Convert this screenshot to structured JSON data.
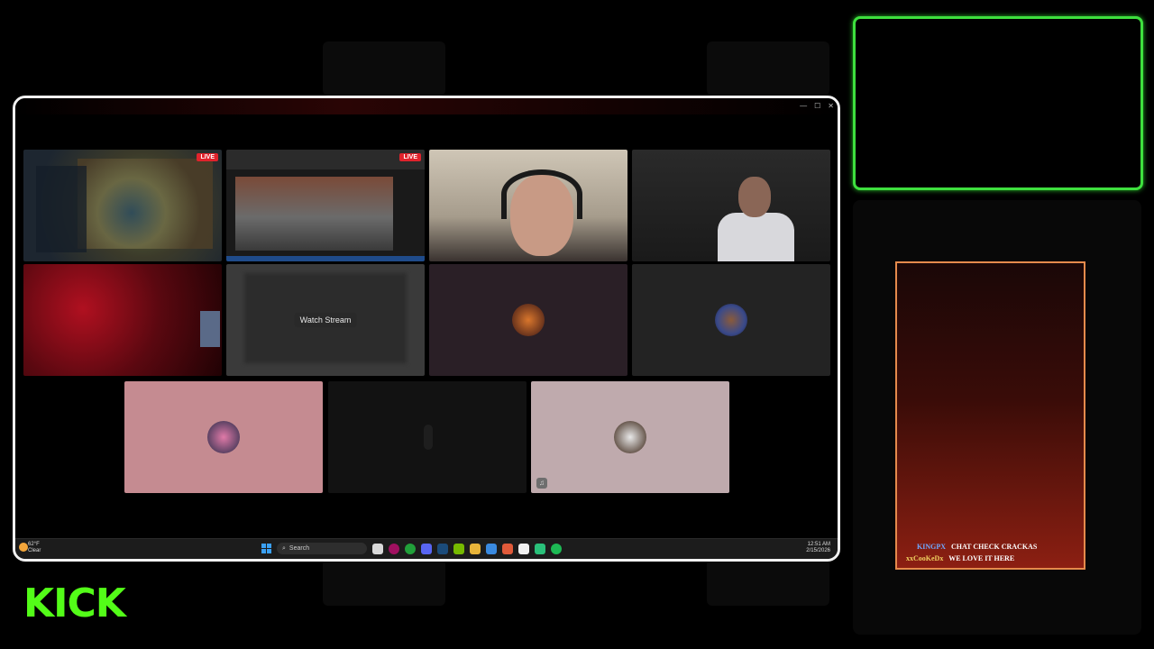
{
  "window": {
    "controls": [
      "—",
      "☐",
      "✕"
    ]
  },
  "grid": {
    "tiles": [
      {
        "kind": "screenshare-game",
        "live_badge": "LIVE"
      },
      {
        "kind": "screenshare-browser",
        "live_badge": "LIVE"
      },
      {
        "kind": "webcam"
      },
      {
        "kind": "webcam"
      },
      {
        "kind": "webcam-red"
      },
      {
        "kind": "screenshare-blurred",
        "overlay_label": "Watch Stream"
      },
      {
        "kind": "avatar",
        "bg": "#2a1f26"
      },
      {
        "kind": "avatar",
        "bg": "#232323"
      },
      {
        "kind": "avatar",
        "bg": "#c58b91"
      },
      {
        "kind": "avatar-dark",
        "bg": "#121212"
      },
      {
        "kind": "avatar",
        "bg": "#bfaaad"
      }
    ]
  },
  "taskbar": {
    "weather_temp": "62°F",
    "weather_desc": "Clear",
    "search_placeholder": "Search",
    "time": "12:51 AM",
    "date": "2/15/2026",
    "app_icons": [
      "file-explorer-icon",
      "media-icon",
      "xbox-icon",
      "discord-icon",
      "steam-icon",
      "nvidia-icon",
      "folder-icon",
      "app-icon",
      "app-icon",
      "store-icon",
      "app-icon",
      "spotify-icon"
    ]
  },
  "chat": {
    "messages": [
      {
        "user": "KINGPX",
        "text": "CHAT CHECK CRACKAS"
      },
      {
        "user": "xxCooKeDx",
        "text": "WE LOVE IT HERE"
      }
    ]
  },
  "brand": {
    "logo_text": "KICK",
    "accent": "#53fc18"
  }
}
